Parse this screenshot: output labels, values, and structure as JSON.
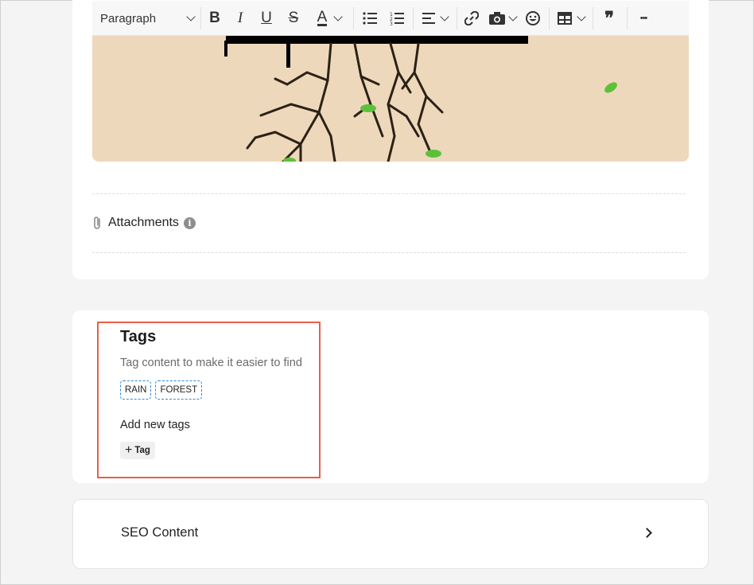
{
  "toolbar": {
    "paragraph_label": "Paragraph",
    "bold_glyph": "B",
    "italic_glyph": "I",
    "underline_glyph": "U",
    "strike_glyph": "S",
    "font_color_glyph": "A",
    "quote_glyph": "❞",
    "more_glyph": "•••"
  },
  "attachments": {
    "label": "Attachments",
    "info_glyph": "i"
  },
  "tags": {
    "title": "Tags",
    "subtitle": "Tag content to make it easier to find",
    "items": [
      "RAIN",
      "FOREST"
    ],
    "add_label": "Add new tags",
    "add_button_label": "Tag",
    "add_button_icon": "+"
  },
  "seo": {
    "label": "SEO Content"
  },
  "colors": {
    "highlight": "#e5604c",
    "chip_border": "#2f8ad6",
    "image_bg": "#eed8bb",
    "leaf_green": "#5cc13a"
  }
}
